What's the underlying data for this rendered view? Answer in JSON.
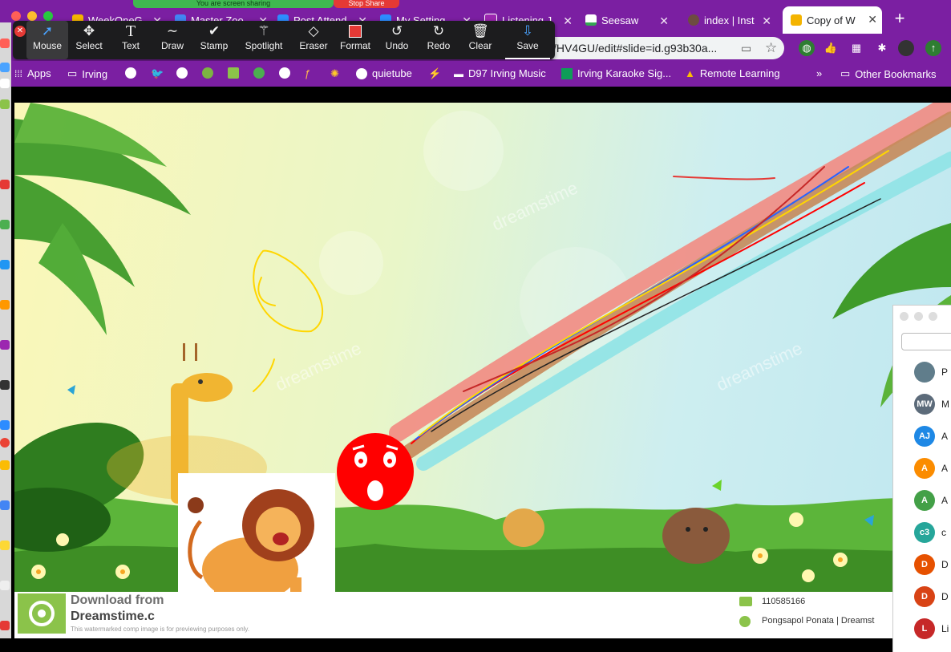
{
  "share_banner": {
    "status": "You are screen sharing",
    "stop_label": "Stop Share"
  },
  "tabs": [
    {
      "label": "WeekOneG",
      "color": "#f4b400"
    },
    {
      "label": "Master Zoo",
      "color": "#4285f4"
    },
    {
      "label": "Post Attend",
      "color": "#2d8cff"
    },
    {
      "label": "My Setting",
      "color": "#2d8cff"
    },
    {
      "label": "Listening J",
      "color": "#7b1fa2"
    },
    {
      "label": "Seesaw",
      "color": "#34a853"
    },
    {
      "label": "index | Inst",
      "color": "#6d4c41"
    },
    {
      "label": "Copy of W",
      "color": "#f4b400"
    }
  ],
  "new_tab_label": "+",
  "address": {
    "url": "/HV4GU/edit#slide=id.g93b30a..."
  },
  "annotation_toolbar": {
    "tools": [
      {
        "label": "Mouse",
        "icon": "cursor-icon"
      },
      {
        "label": "Select",
        "icon": "move-icon"
      },
      {
        "label": "Text",
        "icon": "text-icon"
      },
      {
        "label": "Draw",
        "icon": "draw-icon"
      },
      {
        "label": "Stamp",
        "icon": "check-icon"
      },
      {
        "label": "Spotlight",
        "icon": "wand-icon"
      },
      {
        "label": "Eraser",
        "icon": "eraser-icon"
      },
      {
        "label": "Format",
        "icon": "format-swatch-icon"
      },
      {
        "label": "Undo",
        "icon": "undo-icon"
      },
      {
        "label": "Redo",
        "icon": "redo-icon"
      },
      {
        "label": "Clear",
        "icon": "trash-icon"
      },
      {
        "label": "Save",
        "icon": "save-icon"
      }
    ],
    "selected": "Mouse",
    "format_color": "#e53935"
  },
  "bookmarks": [
    {
      "label": "Apps",
      "icon": "apps-grid-icon"
    },
    {
      "label": "Irving",
      "icon": "folder-icon"
    },
    {
      "label": "quietube",
      "icon": "globe-icon"
    },
    {
      "label": "D97 Irving Music",
      "icon": "d97-icon"
    },
    {
      "label": "Irving Karaoke Sig...",
      "icon": "sheets-icon"
    },
    {
      "label": "Remote Learning",
      "icon": "drive-icon"
    },
    {
      "label": "»",
      "icon": "more-icon"
    },
    {
      "label": "Other Bookmarks",
      "icon": "folder-icon"
    }
  ],
  "slide": {
    "watermark_title": "Download from",
    "watermark_brand": "Dreamstime.c",
    "watermark_note": "This watermarked comp image is for previewing purposes only.",
    "image_id": "110585166",
    "author": "Pongsapol Ponata | Dreamst"
  },
  "participants": [
    {
      "initials": "",
      "color": "#607d8b",
      "name": "P"
    },
    {
      "initials": "MW",
      "color": "#5c6b7a",
      "name": "M"
    },
    {
      "initials": "AJ",
      "color": "#1e88e5",
      "name": "A"
    },
    {
      "initials": "A",
      "color": "#fb8c00",
      "name": "A"
    },
    {
      "initials": "A",
      "color": "#43a047",
      "name": "A"
    },
    {
      "initials": "c3",
      "color": "#26a69a",
      "name": "c"
    },
    {
      "initials": "D",
      "color": "#e65100",
      "name": "D"
    },
    {
      "initials": "D",
      "color": "#d84315",
      "name": "D"
    },
    {
      "initials": "L",
      "color": "#c62828",
      "name": "Li"
    }
  ]
}
